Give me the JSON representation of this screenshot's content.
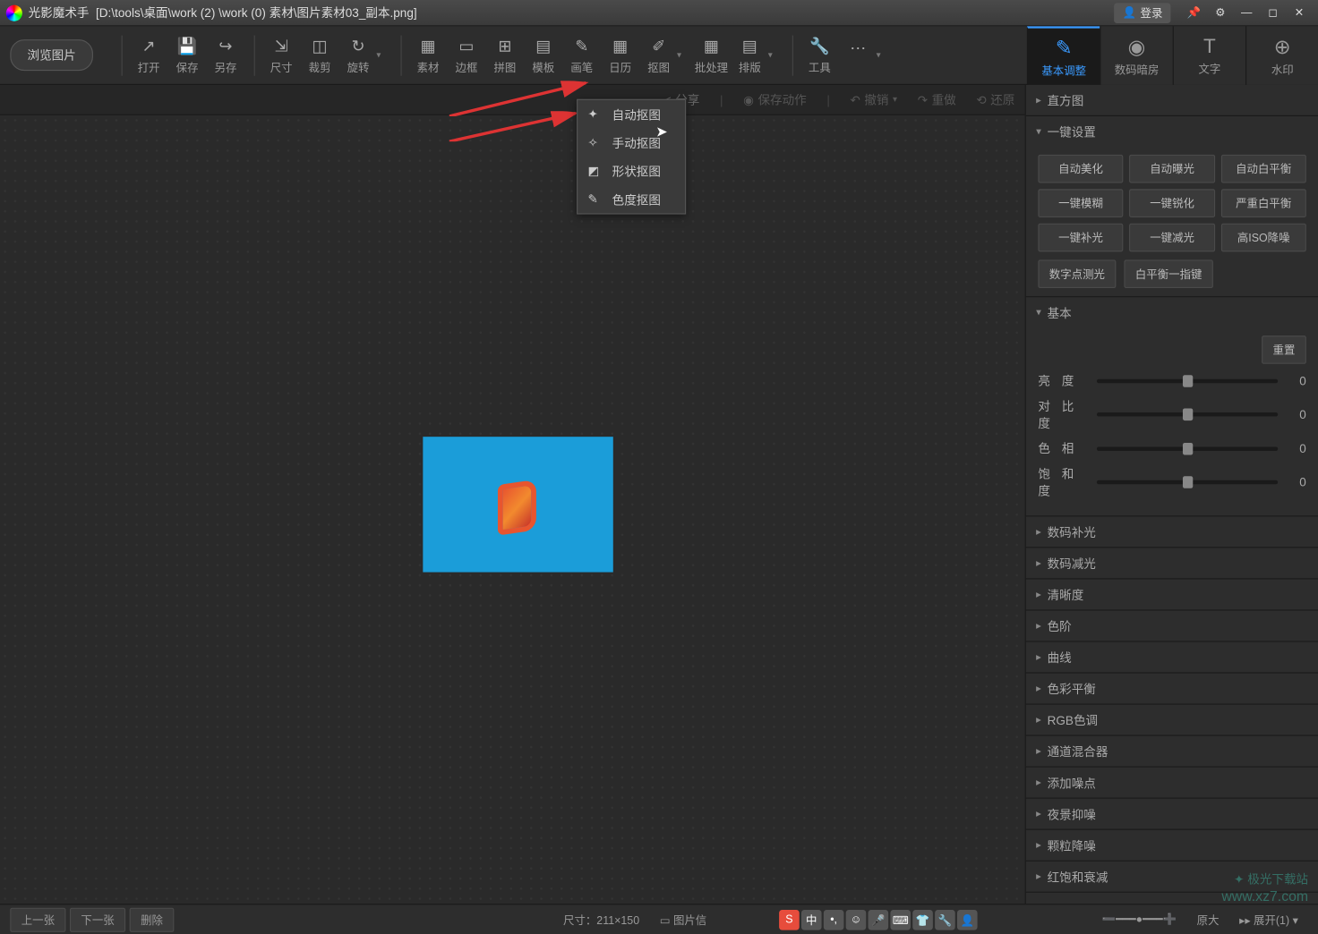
{
  "titlebar": {
    "app_name": "光影魔术手",
    "file_path": "[D:\\tools\\桌面\\work (2) \\work (0) 素材\\图片素材03_副本.png]",
    "login": "登录"
  },
  "toolbar": {
    "browse": "浏览图片",
    "items": [
      {
        "label": "打开",
        "icon": "⬚"
      },
      {
        "label": "保存",
        "icon": "💾"
      },
      {
        "label": "另存",
        "icon": "📤"
      },
      {
        "label": "尺寸",
        "icon": "⇲"
      },
      {
        "label": "裁剪",
        "icon": "✂"
      },
      {
        "label": "旋转",
        "icon": "↻"
      },
      {
        "label": "素材",
        "icon": "▦"
      },
      {
        "label": "边框",
        "icon": "▭"
      },
      {
        "label": "拼图",
        "icon": "▦"
      },
      {
        "label": "模板",
        "icon": "▤"
      },
      {
        "label": "画笔",
        "icon": "✎"
      },
      {
        "label": "日历",
        "icon": "▦"
      },
      {
        "label": "抠图",
        "icon": "✐"
      },
      {
        "label": "批处理",
        "icon": "▦"
      },
      {
        "label": "排版",
        "icon": "▤"
      },
      {
        "label": "工具",
        "icon": "🔧"
      }
    ],
    "more": "⋯"
  },
  "right_tabs": [
    {
      "label": "基本调整",
      "icon": "✎"
    },
    {
      "label": "数码暗房",
      "icon": "◉"
    },
    {
      "label": "文字",
      "icon": "T"
    },
    {
      "label": "水印",
      "icon": "⊕"
    }
  ],
  "subtoolbar": {
    "share": "分享",
    "save_action": "保存动作",
    "undo": "撤销",
    "redo": "重做",
    "restore": "还原"
  },
  "dropdown": [
    {
      "label": "自动抠图",
      "icon": "✦"
    },
    {
      "label": "手动抠图",
      "icon": "✧"
    },
    {
      "label": "形状抠图",
      "icon": "◩"
    },
    {
      "label": "色度抠图",
      "icon": "✎"
    }
  ],
  "panel": {
    "histogram": "直方图",
    "oneclick": {
      "title": "一键设置",
      "buttons": [
        "自动美化",
        "自动曝光",
        "自动白平衡",
        "一键模糊",
        "一键锐化",
        "严重白平衡",
        "一键补光",
        "一键减光",
        "高ISO降噪"
      ],
      "extra": [
        "数字点测光",
        "白平衡一指键"
      ]
    },
    "basic": {
      "title": "基本",
      "reset": "重置",
      "sliders": [
        {
          "label": "亮   度",
          "value": "0"
        },
        {
          "label": "对 比 度",
          "value": "0"
        },
        {
          "label": "色   相",
          "value": "0"
        },
        {
          "label": "饱 和 度",
          "value": "0"
        }
      ]
    },
    "sections": [
      "数码补光",
      "数码减光",
      "清晰度",
      "色阶",
      "曲线",
      "色彩平衡",
      "RGB色调",
      "通道混合器",
      "添加噪点",
      "夜景抑噪",
      "颗粒降噪",
      "红饱和衰减"
    ]
  },
  "bottom": {
    "prev": "上一张",
    "next": "下一张",
    "delete": "删除",
    "size_label": "尺寸：",
    "size_value": "211×150",
    "info": "图片信",
    "expand": "展开(1)",
    "original": "原大",
    "ime": "中"
  },
  "watermark": {
    "line1": "极光下载站",
    "line2": "www.xz7.com"
  }
}
